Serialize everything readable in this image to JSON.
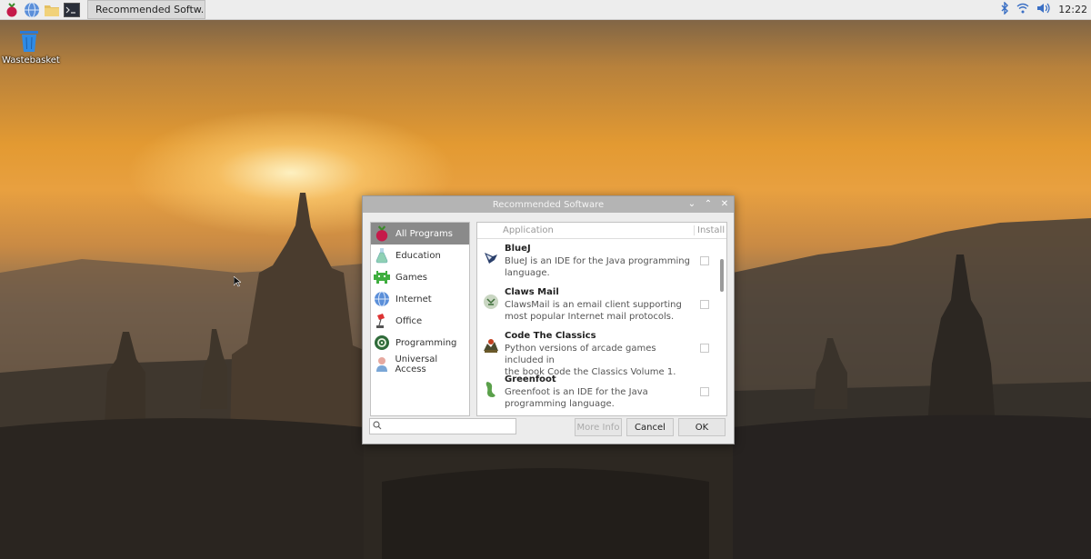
{
  "taskbar": {
    "task_label": "Recommended Softw...",
    "clock": "12:22"
  },
  "desktop": {
    "wastebasket_label": "Wastebasket"
  },
  "dialog": {
    "title": "Recommended Software",
    "categories": [
      {
        "label": "All Programs",
        "icon": "raspberry-icon",
        "selected": true
      },
      {
        "label": "Education",
        "icon": "flask-icon"
      },
      {
        "label": "Games",
        "icon": "invader-icon"
      },
      {
        "label": "Internet",
        "icon": "globe-icon"
      },
      {
        "label": "Office",
        "icon": "lamp-icon"
      },
      {
        "label": "Programming",
        "icon": "gear-icon"
      },
      {
        "label": "Universal Access",
        "icon": "person-icon"
      }
    ],
    "columns": {
      "application": "Application",
      "install": "Install"
    },
    "apps": [
      {
        "name": "BlueJ",
        "desc1": "BlueJ is an IDE for the Java programming",
        "desc2": "language.",
        "icon": "bird-icon"
      },
      {
        "name": "Claws Mail",
        "desc1": "ClawsMail is an email client supporting",
        "desc2": "most popular Internet mail protocols.",
        "icon": "claws-icon"
      },
      {
        "name": "Code The Classics",
        "desc1": "Python versions of arcade games included in",
        "desc2": "the book Code the Classics Volume 1.",
        "icon": "arcade-icon"
      },
      {
        "name": "Greenfoot",
        "desc1": "Greenfoot is an IDE for the Java",
        "desc2": "programming language.",
        "icon": "foot-icon"
      }
    ],
    "search_placeholder": "",
    "buttons": {
      "more_info": "More Info",
      "cancel": "Cancel",
      "ok": "OK"
    }
  }
}
